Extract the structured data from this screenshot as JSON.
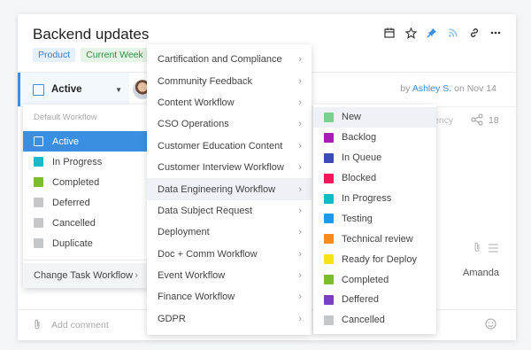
{
  "task": {
    "title": "Backend updates",
    "tags": [
      "Product",
      "Current Week"
    ],
    "status_label": "Active",
    "byline_prefix": "by",
    "author": "Ashley S.",
    "byline_suffix": "on Nov 14"
  },
  "header_icons": [
    "calendar-icon",
    "star-icon",
    "pin-icon",
    "rss-icon",
    "link-icon",
    "more-icon"
  ],
  "background": {
    "frequency_fragment": "ency",
    "share_count": "18",
    "assignee": "Amanda",
    "comment_placeholder": "Add comment"
  },
  "status_menu": {
    "heading": "Default Workflow",
    "items": [
      {
        "label": "Active",
        "color": "#3b8fe0",
        "selected": true
      },
      {
        "label": "In Progress",
        "color": "#1db9c8",
        "selected": false
      },
      {
        "label": "Completed",
        "color": "#7bbd2c",
        "selected": false
      },
      {
        "label": "Deferred",
        "color": "#c5c7ca",
        "selected": false
      },
      {
        "label": "Cancelled",
        "color": "#c5c7ca",
        "selected": false
      },
      {
        "label": "Duplicate",
        "color": "#c5c7ca",
        "selected": false
      }
    ],
    "change_workflow": "Change Task Workflow"
  },
  "workflow_menu": {
    "hovered": "Data Engineering Workflow",
    "items": [
      "Cartification and Compliance",
      "Community Feedback",
      "Content Workflow",
      "CSO Operations",
      "Customer Education Content",
      "Customer Interview Workflow",
      "Data Engineering Workflow",
      "Data Subject Request",
      "Deployment",
      "Doc + Comm Workflow",
      "Event Workflow",
      "Finance Workflow",
      "GDPR"
    ]
  },
  "workflow_statuses": {
    "hovered": "New",
    "items": [
      {
        "label": "New",
        "color": "#7dcf8f"
      },
      {
        "label": "Backlog",
        "color": "#a51fb1"
      },
      {
        "label": "In Queue",
        "color": "#3b4db5"
      },
      {
        "label": "Blocked",
        "color": "#f0185a"
      },
      {
        "label": "In Progress",
        "color": "#14b9c6"
      },
      {
        "label": "Testing",
        "color": "#1e9ae8"
      },
      {
        "label": "Technical review",
        "color": "#f58a1f"
      },
      {
        "label": "Ready for Deploy",
        "color": "#f5e31a"
      },
      {
        "label": "Completed",
        "color": "#7bbd2c"
      },
      {
        "label": "Deffered",
        "color": "#7a3fc0"
      },
      {
        "label": "Cancelled",
        "color": "#c5c7ca"
      }
    ]
  }
}
